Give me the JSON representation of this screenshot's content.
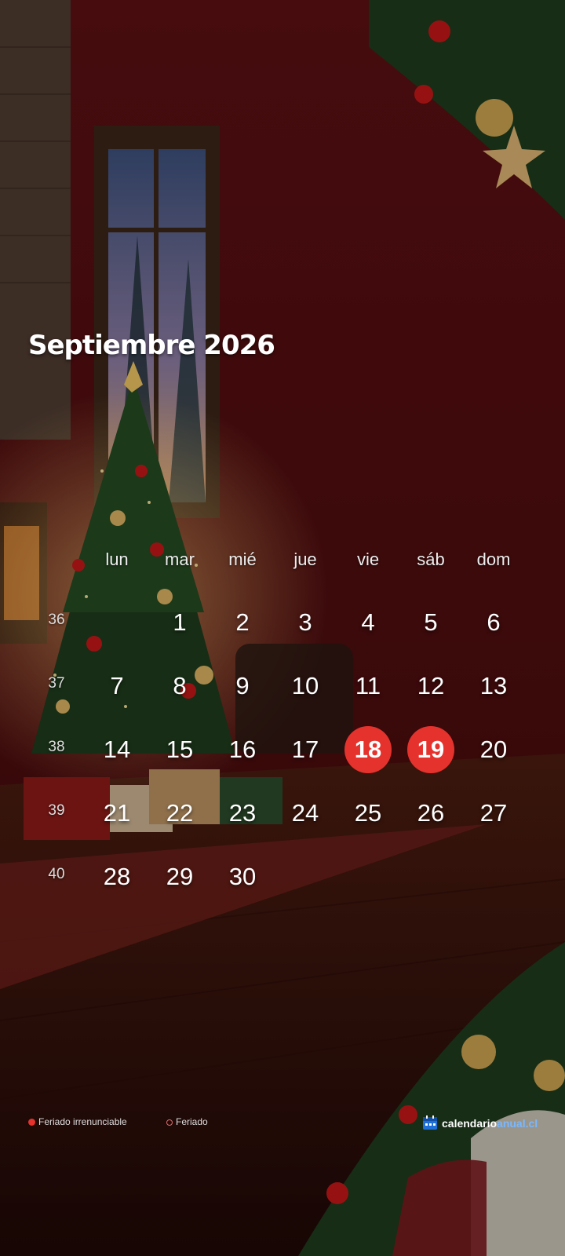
{
  "calendar": {
    "title": "Septiembre 2026",
    "weekdays": [
      "lun",
      "mar",
      "mié",
      "jue",
      "vie",
      "sáb",
      "dom"
    ],
    "weeks": [
      {
        "week": "36",
        "days": [
          "",
          "1",
          "2",
          "3",
          "4",
          "5",
          "6"
        ]
      },
      {
        "week": "37",
        "days": [
          "7",
          "8",
          "9",
          "10",
          "11",
          "12",
          "13"
        ]
      },
      {
        "week": "38",
        "days": [
          "14",
          "15",
          "16",
          "17",
          "18",
          "19",
          "20"
        ]
      },
      {
        "week": "39",
        "days": [
          "21",
          "22",
          "23",
          "24",
          "25",
          "26",
          "27"
        ]
      },
      {
        "week": "40",
        "days": [
          "28",
          "29",
          "30",
          "",
          "",
          "",
          ""
        ]
      }
    ],
    "holidays_irrenunciable": [
      "18",
      "19"
    ]
  },
  "legend": {
    "irrenunciable": "Feriado irrenunciable",
    "feriado": "Feriado"
  },
  "brand": {
    "icon": "calendar-icon",
    "part1": "calendario",
    "part2": "anual.cl"
  },
  "colors": {
    "holiday": "#e5322d",
    "brand_accent": "#7ab8ff"
  }
}
